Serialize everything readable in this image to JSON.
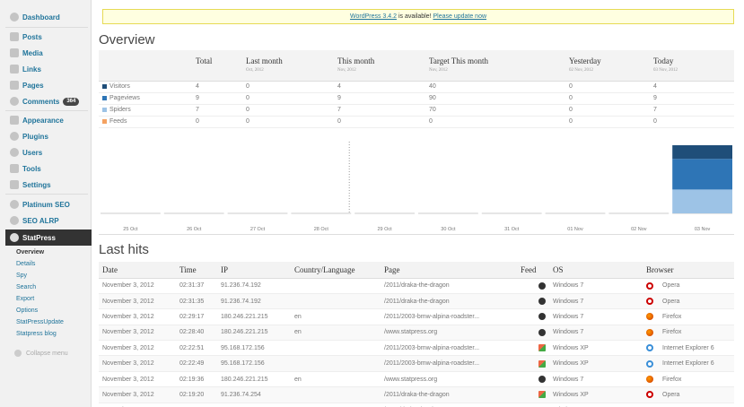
{
  "sidebar": {
    "items": [
      {
        "label": "Dashboard",
        "icon": "dashboard-icon"
      },
      {
        "label": "Posts",
        "icon": "posts-icon"
      },
      {
        "label": "Media",
        "icon": "media-icon"
      },
      {
        "label": "Links",
        "icon": "links-icon"
      },
      {
        "label": "Pages",
        "icon": "pages-icon"
      },
      {
        "label": "Comments",
        "icon": "comments-icon",
        "badge": "364"
      },
      {
        "label": "Appearance",
        "icon": "appearance-icon"
      },
      {
        "label": "Plugins",
        "icon": "plugins-icon"
      },
      {
        "label": "Users",
        "icon": "users-icon"
      },
      {
        "label": "Tools",
        "icon": "tools-icon"
      },
      {
        "label": "Settings",
        "icon": "settings-icon"
      },
      {
        "label": "Platinum SEO",
        "icon": "platinum-seo-icon"
      },
      {
        "label": "SEO ALRP",
        "icon": "seo-alrp-icon"
      },
      {
        "label": "StatPress",
        "icon": "statpress-icon"
      }
    ],
    "submenu": [
      "Overview",
      "Details",
      "Spy",
      "Search",
      "Export",
      "Options",
      "StatPressUpdate",
      "Statpress blog"
    ],
    "collapse_label": "Collapse menu"
  },
  "notice": {
    "version_link": "WordPress 3.4.2",
    "middle": " is available! ",
    "update_link": "Please update now"
  },
  "overview": {
    "title": "Overview",
    "columns": [
      {
        "label": "",
        "sub": ""
      },
      {
        "label": "Total",
        "sub": ""
      },
      {
        "label": "Last month",
        "sub": "Oct, 2012"
      },
      {
        "label": "This month",
        "sub": "Nov, 2012"
      },
      {
        "label": "Target This month",
        "sub": "Nov, 2012"
      },
      {
        "label": "Yesterday",
        "sub": "02 Nov, 2012"
      },
      {
        "label": "Today",
        "sub": "03 Nov, 2012"
      }
    ],
    "rows": [
      {
        "label": "Visitors",
        "color": "#1f4e79",
        "values": [
          "4",
          "0",
          "4",
          "40",
          "0",
          "4"
        ]
      },
      {
        "label": "Pageviews",
        "color": "#2e75b6",
        "values": [
          "9",
          "0",
          "9",
          "90",
          "0",
          "9"
        ]
      },
      {
        "label": "Spiders",
        "color": "#9dc3e6",
        "values": [
          "7",
          "0",
          "7",
          "70",
          "0",
          "7"
        ]
      },
      {
        "label": "Feeds",
        "color": "#f4a261",
        "values": [
          "0",
          "0",
          "0",
          "0",
          "0",
          "0"
        ]
      }
    ]
  },
  "chart_data": {
    "type": "bar",
    "categories": [
      "25 Oct",
      "26 Oct",
      "27 Oct",
      "28 Oct",
      "29 Oct",
      "30 Oct",
      "31 Oct",
      "01 Nov",
      "02 Nov",
      "03 Nov"
    ],
    "series": [
      {
        "name": "Visitors",
        "color": "#1f4e79",
        "values": [
          0,
          0,
          0,
          0,
          0,
          0,
          0,
          0,
          0,
          4
        ]
      },
      {
        "name": "Pageviews",
        "color": "#2e75b6",
        "values": [
          0,
          0,
          0,
          0,
          0,
          0,
          0,
          0,
          0,
          9
        ]
      },
      {
        "name": "Spiders",
        "color": "#9dc3e6",
        "values": [
          0,
          0,
          0,
          0,
          0,
          0,
          0,
          0,
          0,
          7
        ]
      }
    ],
    "stacked": true,
    "ylim": [
      0,
      20
    ],
    "grid": false,
    "xlabel": "",
    "ylabel": "",
    "title": ""
  },
  "hits": {
    "title": "Last hits",
    "columns": [
      "Date",
      "Time",
      "IP",
      "Country/Language",
      "Page",
      "Feed",
      "OS",
      "Browser"
    ],
    "rows": [
      {
        "date": "November 3, 2012",
        "time": "02:31:37",
        "ip": "91.236.74.192",
        "lang": "",
        "page": "/2011/draka-the-dragon",
        "feed": "",
        "os_icon": "mac",
        "os": "Windows 7",
        "browser_icon": "opera",
        "browser": "Opera"
      },
      {
        "date": "November 3, 2012",
        "time": "02:31:35",
        "ip": "91.236.74.192",
        "lang": "",
        "page": "/2011/draka-the-dragon",
        "feed": "",
        "os_icon": "mac",
        "os": "Windows 7",
        "browser_icon": "opera",
        "browser": "Opera"
      },
      {
        "date": "November 3, 2012",
        "time": "02:29:17",
        "ip": "180.246.221.215",
        "lang": "en",
        "page": "/2011/2003-bmw-alpina-roadster...",
        "feed": "",
        "os_icon": "mac",
        "os": "Windows 7",
        "browser_icon": "firefox",
        "browser": "Firefox"
      },
      {
        "date": "November 3, 2012",
        "time": "02:28:40",
        "ip": "180.246.221.215",
        "lang": "en",
        "page": "/www.statpress.org",
        "feed": "",
        "os_icon": "mac",
        "os": "Windows 7",
        "browser_icon": "firefox",
        "browser": "Firefox"
      },
      {
        "date": "November 3, 2012",
        "time": "02:22:51",
        "ip": "95.168.172.156",
        "lang": "",
        "page": "/2011/2003-bmw-alpina-roadster...",
        "feed": "",
        "os_icon": "win",
        "os": "Windows XP",
        "browser_icon": "ie",
        "browser": "Internet Explorer 6"
      },
      {
        "date": "November 3, 2012",
        "time": "02:22:49",
        "ip": "95.168.172.156",
        "lang": "",
        "page": "/2011/2003-bmw-alpina-roadster...",
        "feed": "",
        "os_icon": "win",
        "os": "Windows XP",
        "browser_icon": "ie",
        "browser": "Internet Explorer 6"
      },
      {
        "date": "November 3, 2012",
        "time": "02:19:36",
        "ip": "180.246.221.215",
        "lang": "en",
        "page": "/www.statpress.org",
        "feed": "",
        "os_icon": "mac",
        "os": "Windows 7",
        "browser_icon": "firefox",
        "browser": "Firefox"
      },
      {
        "date": "November 3, 2012",
        "time": "02:19:20",
        "ip": "91.236.74.254",
        "lang": "",
        "page": "/2011/draka-the-dragon",
        "feed": "",
        "os_icon": "win",
        "os": "Windows XP",
        "browser_icon": "opera",
        "browser": "Opera"
      },
      {
        "date": "November 3, 2012",
        "time": "02:19:15",
        "ip": "91.236.74.254",
        "lang": "",
        "page": "/2011/draka-the-dragon",
        "feed": "",
        "os_icon": "win",
        "os": "Windows XP",
        "browser_icon": "opera",
        "browser": "Opera"
      }
    ]
  }
}
